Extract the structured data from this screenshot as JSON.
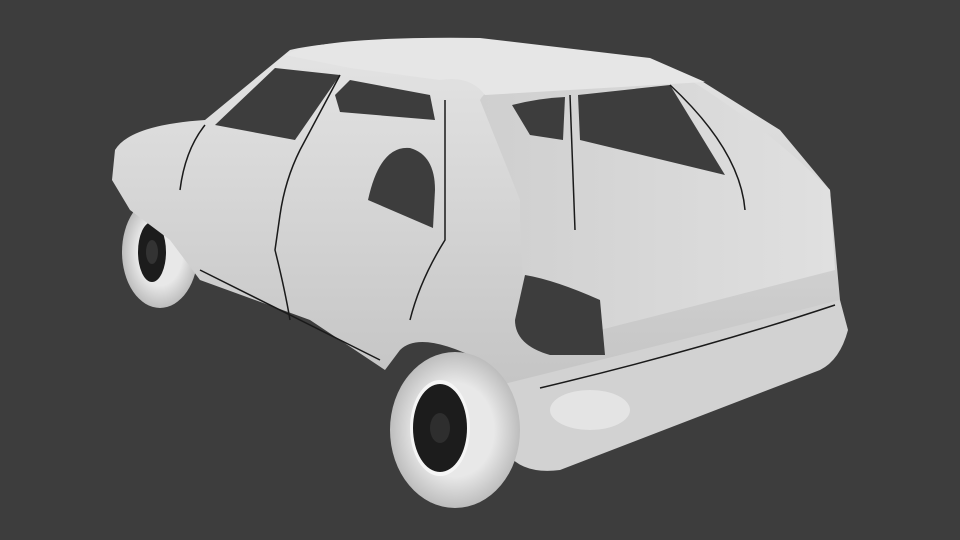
{
  "scene": {
    "subject": "car-model-render",
    "colors": {
      "background": "#3d3d3d",
      "body": "#d6d6d6",
      "body_shadow": "#b8b8b8",
      "highlight": "#f2f2f2",
      "seam": "#1a1a1a",
      "tire": "#dcdcdc",
      "rim": "#1c1c1c"
    }
  }
}
